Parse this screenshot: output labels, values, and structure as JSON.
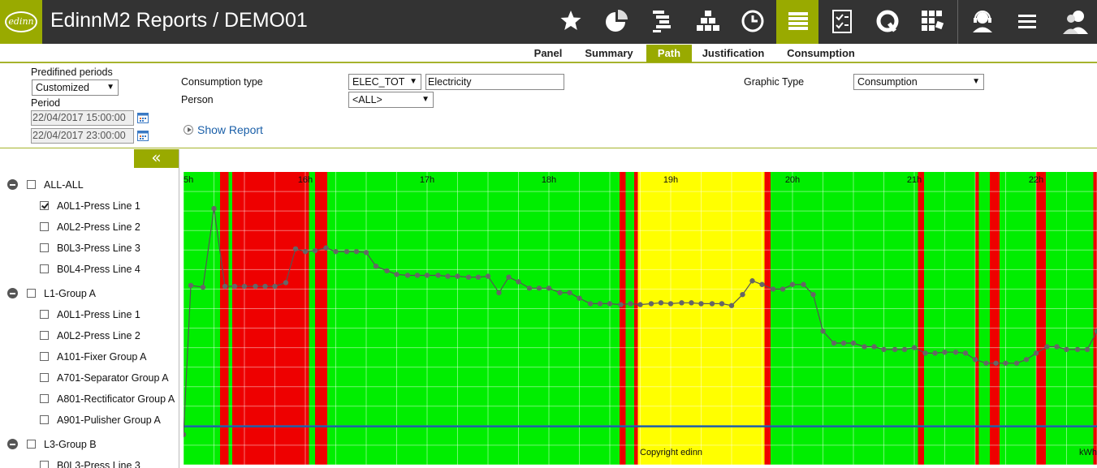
{
  "header": {
    "logo_text": "edinn",
    "title": "EdinnM2 Reports / DEMO01",
    "nav_icons": [
      {
        "name": "star-icon",
        "active": false
      },
      {
        "name": "pie-chart-icon",
        "active": false
      },
      {
        "name": "gantt-icon",
        "active": false
      },
      {
        "name": "hierarchy-icon",
        "active": false
      },
      {
        "name": "clock-icon",
        "active": false
      },
      {
        "name": "stack-icon",
        "active": true
      },
      {
        "name": "checklist-icon",
        "active": false
      },
      {
        "name": "q-icon",
        "active": false
      },
      {
        "name": "grid-icon",
        "active": false
      },
      {
        "name": "support-agent-icon",
        "active": false
      },
      {
        "name": "menu-icon",
        "active": false
      },
      {
        "name": "users-icon",
        "active": false
      }
    ],
    "accent": "#99aa00"
  },
  "tabs": [
    {
      "label": "Panel",
      "active": false
    },
    {
      "label": "Summary",
      "active": false
    },
    {
      "label": "Path",
      "active": true
    },
    {
      "label": "Justification",
      "active": false
    },
    {
      "label": "Consumption",
      "active": false
    }
  ],
  "filters": {
    "predefined_periods_label": "Predifined periods",
    "predefined_periods_value": "Customized",
    "period_label": "Period",
    "period_from": "22/04/2017 15:00:00",
    "period_to": "22/04/2017 23:00:00",
    "consumption_type_label": "Consumption type",
    "consumption_type_code": "ELEC_TOT",
    "consumption_type_name": "Electricity",
    "person_label": "Person",
    "person_value": "<ALL>",
    "graphic_type_label": "Graphic Type",
    "graphic_type_value": "Consumption",
    "show_report": "Show Report"
  },
  "tree": {
    "collapse_symbol": "«",
    "nodes": [
      {
        "label": "ALL-ALL",
        "level": 0,
        "group": true,
        "checked": false
      },
      {
        "label": "A0L1-Press Line 1",
        "level": 1,
        "group": false,
        "checked": true
      },
      {
        "label": "A0L2-Press Line 2",
        "level": 1,
        "group": false,
        "checked": false
      },
      {
        "label": "B0L3-Press Line 3",
        "level": 1,
        "group": false,
        "checked": false
      },
      {
        "label": "B0L4-Press Line 4",
        "level": 1,
        "group": false,
        "checked": false
      },
      {
        "label": "L1-Group A",
        "level": 0,
        "group": true,
        "checked": false
      },
      {
        "label": "A0L1-Press Line 1",
        "level": 1,
        "group": false,
        "checked": false
      },
      {
        "label": "A0L2-Press Line 2",
        "level": 1,
        "group": false,
        "checked": false
      },
      {
        "label": "A101-Fixer Group A",
        "level": 1,
        "group": false,
        "checked": false
      },
      {
        "label": "A701-Separator Group A",
        "level": 1,
        "group": false,
        "checked": false
      },
      {
        "label": "A801-Rectificator Group A",
        "level": 1,
        "group": false,
        "checked": false
      },
      {
        "label": "A901-Pulisher Group A",
        "level": 1,
        "group": false,
        "checked": false
      },
      {
        "label": "L3-Group B",
        "level": 0,
        "group": true,
        "checked": false
      },
      {
        "label": "B0L3-Press Line 3",
        "level": 1,
        "group": false,
        "checked": false
      }
    ]
  },
  "chart_data": {
    "type": "line",
    "x_start_hour": 15.0,
    "x_end_hour": 22.5,
    "tick_hours": [
      15,
      16,
      17,
      18,
      19,
      20,
      21,
      22
    ],
    "tick_labels": [
      "5h",
      "16h",
      "17h",
      "18h",
      "19h",
      "20h",
      "21h",
      "22h"
    ],
    "copyright": "Copyright edinn",
    "unit_label": "kWh",
    "colors": {
      "green": "#00ee00",
      "red": "#ee0000",
      "yellow": "#ffff00",
      "line": "#555555",
      "point": "#666666",
      "hline": "#1f5fa8"
    },
    "states": [
      {
        "from": 15.0,
        "to": 15.3,
        "state": "green"
      },
      {
        "from": 15.3,
        "to": 15.37,
        "state": "red"
      },
      {
        "from": 15.37,
        "to": 15.4,
        "state": "green"
      },
      {
        "from": 15.4,
        "to": 16.03,
        "state": "red"
      },
      {
        "from": 16.03,
        "to": 16.08,
        "state": "green"
      },
      {
        "from": 16.08,
        "to": 16.18,
        "state": "red"
      },
      {
        "from": 16.18,
        "to": 17.6,
        "state": "green"
      },
      {
        "from": 17.6,
        "to": 17.6,
        "state": "green"
      },
      {
        "from": 17.6,
        "to": 18.58,
        "state": "green"
      },
      {
        "from": 18.58,
        "to": 18.63,
        "state": "red"
      },
      {
        "from": 18.63,
        "to": 18.7,
        "state": "green"
      },
      {
        "from": 18.7,
        "to": 18.73,
        "state": "red"
      },
      {
        "from": 18.73,
        "to": 19.77,
        "state": "yellow"
      },
      {
        "from": 19.77,
        "to": 19.82,
        "state": "red"
      },
      {
        "from": 19.82,
        "to": 21.03,
        "state": "green"
      },
      {
        "from": 21.03,
        "to": 21.08,
        "state": "red"
      },
      {
        "from": 21.08,
        "to": 21.5,
        "state": "green"
      },
      {
        "from": 21.5,
        "to": 21.53,
        "state": "red"
      },
      {
        "from": 21.53,
        "to": 21.62,
        "state": "green"
      },
      {
        "from": 21.62,
        "to": 21.7,
        "state": "red"
      },
      {
        "from": 21.7,
        "to": 22.0,
        "state": "green"
      },
      {
        "from": 22.0,
        "to": 22.08,
        "state": "red"
      },
      {
        "from": 22.08,
        "to": 22.47,
        "state": "green"
      },
      {
        "from": 22.47,
        "to": 22.5,
        "state": "red"
      }
    ],
    "series": [
      {
        "values": [
          [
            15.0,
            33
          ],
          [
            15.06,
            196
          ],
          [
            15.16,
            194
          ],
          [
            15.25,
            280
          ],
          [
            15.34,
            195
          ],
          [
            15.42,
            195
          ],
          [
            15.5,
            195
          ],
          [
            15.59,
            195
          ],
          [
            15.67,
            195
          ],
          [
            15.75,
            195
          ],
          [
            15.84,
            199
          ],
          [
            15.92,
            236
          ],
          [
            16.0,
            233
          ],
          [
            16.08,
            234
          ],
          [
            16.17,
            237
          ],
          [
            16.25,
            233
          ],
          [
            16.34,
            233
          ],
          [
            16.42,
            233
          ],
          [
            16.5,
            232
          ],
          [
            16.58,
            217
          ],
          [
            16.67,
            212
          ],
          [
            16.75,
            208
          ],
          [
            16.84,
            207
          ],
          [
            16.92,
            207
          ],
          [
            17.0,
            207
          ],
          [
            17.09,
            207
          ],
          [
            17.17,
            206
          ],
          [
            17.25,
            206
          ],
          [
            17.34,
            205
          ],
          [
            17.42,
            205
          ],
          [
            17.5,
            206
          ],
          [
            17.59,
            188
          ],
          [
            17.67,
            205
          ],
          [
            17.75,
            200
          ],
          [
            17.84,
            193
          ],
          [
            17.92,
            193
          ],
          [
            18.0,
            193
          ],
          [
            18.09,
            188
          ],
          [
            18.17,
            188
          ],
          [
            18.25,
            182
          ],
          [
            18.34,
            176
          ],
          [
            18.42,
            176
          ],
          [
            18.5,
            176
          ],
          [
            18.59,
            175
          ],
          [
            18.67,
            176
          ],
          [
            18.75,
            175
          ],
          [
            18.84,
            176
          ],
          [
            18.92,
            177
          ],
          [
            19.0,
            176
          ],
          [
            19.09,
            177
          ],
          [
            19.17,
            177
          ],
          [
            19.25,
            176
          ],
          [
            19.34,
            176
          ],
          [
            19.42,
            176
          ],
          [
            19.5,
            174
          ],
          [
            19.59,
            186
          ],
          [
            19.67,
            201
          ],
          [
            19.75,
            197
          ],
          [
            19.84,
            192
          ],
          [
            19.92,
            192
          ],
          [
            20.0,
            197
          ],
          [
            20.09,
            197
          ],
          [
            20.17,
            186
          ],
          [
            20.25,
            146
          ],
          [
            20.34,
            133
          ],
          [
            20.42,
            133
          ],
          [
            20.5,
            133
          ],
          [
            20.59,
            129
          ],
          [
            20.67,
            129
          ],
          [
            20.75,
            126
          ],
          [
            20.84,
            126
          ],
          [
            20.92,
            126
          ],
          [
            21.0,
            128
          ],
          [
            21.09,
            122
          ],
          [
            21.17,
            122
          ],
          [
            21.25,
            123
          ],
          [
            21.34,
            123
          ],
          [
            21.42,
            122
          ],
          [
            21.5,
            115
          ],
          [
            21.59,
            111
          ],
          [
            21.67,
            111
          ],
          [
            21.75,
            111
          ],
          [
            21.84,
            111
          ],
          [
            21.92,
            115
          ],
          [
            22.0,
            122
          ],
          [
            22.09,
            129
          ],
          [
            22.17,
            129
          ],
          [
            22.25,
            126
          ],
          [
            22.34,
            126
          ],
          [
            22.42,
            126
          ],
          [
            22.5,
            146
          ],
          [
            22.55,
            140
          ]
        ]
      }
    ],
    "ylim": [
      0,
      320
    ]
  }
}
